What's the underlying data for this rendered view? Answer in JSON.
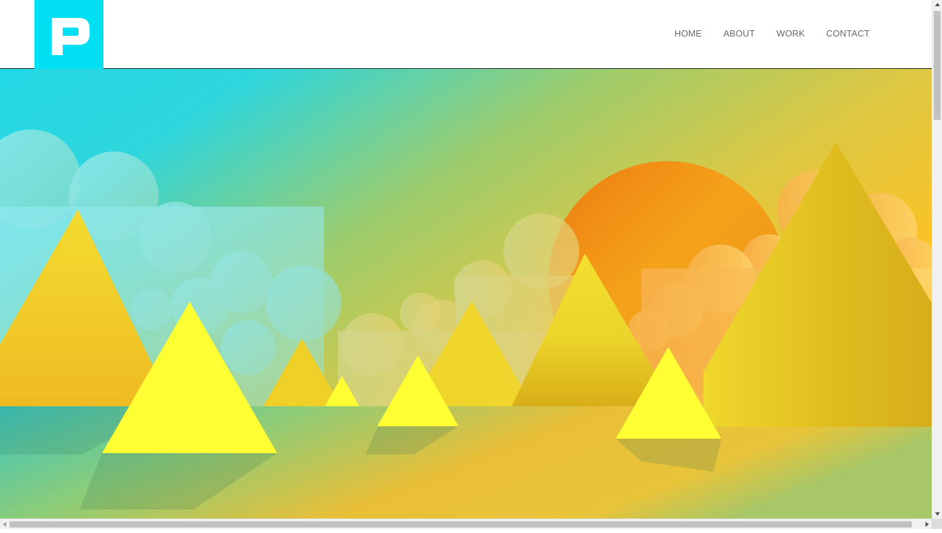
{
  "header": {
    "logo_letter": "P",
    "logo_color": "#00e0f2"
  },
  "nav": {
    "items": [
      {
        "label": "HOME"
      },
      {
        "label": "ABOUT"
      },
      {
        "label": "WORK"
      },
      {
        "label": "CONTACT"
      }
    ],
    "text_color": "#666666"
  },
  "hero": {
    "sky_colors": [
      "#22d8e6",
      "#b9cc5a",
      "#fcc224"
    ],
    "sun_color": "#f29a12",
    "mountain_color": "#f2d92e",
    "foreground_triangle_color": "#ffff33"
  },
  "scrollbars": {
    "vertical": "vertical-scrollbar",
    "horizontal": "horizontal-scrollbar"
  }
}
